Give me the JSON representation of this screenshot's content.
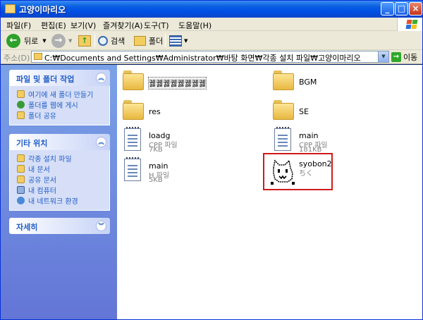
{
  "window": {
    "title": "고양이마리오"
  },
  "menu": [
    "파일(F)",
    "편집(E)",
    "보기(V)",
    "즐겨찾기(A)",
    "도구(T)",
    "도움말(H)"
  ],
  "toolbar": {
    "back": "뒤로",
    "search": "검색",
    "folders": "폴더"
  },
  "address": {
    "label": "주소(D)",
    "path": "C:₩Documents and Settings₩Administrator₩바탕 화면₩각종 설치 파일₩고양이마리오",
    "go": "이동"
  },
  "panels": [
    {
      "title": "파일 및 폴더 작업",
      "links": [
        "여기에 새 폴더 만들기",
        "폴더를 웹에 게시",
        "폴더 공유"
      ]
    },
    {
      "title": "기타 위치",
      "links": [
        "각종 설치 파일",
        "내 문서",
        "공유 문서",
        "내 컴퓨터",
        "내 네트워크 환경"
      ]
    },
    {
      "title": "자세히",
      "links": []
    }
  ],
  "files": [
    {
      "name": "궳궳궳궳궳궳궳궳",
      "kind": "folder"
    },
    {
      "name": "BGM",
      "kind": "folder"
    },
    {
      "name": "res",
      "kind": "folder"
    },
    {
      "name": "SE",
      "kind": "folder"
    },
    {
      "name": "loadg",
      "type": "CPP 파일",
      "size": "7KB",
      "kind": "doc"
    },
    {
      "name": "main",
      "type": "CPP 파일",
      "size": "181KB",
      "kind": "doc"
    },
    {
      "name": "main",
      "type": "H 파일",
      "size": "5KB",
      "kind": "doc"
    },
    {
      "name": "syobon2",
      "type": "ちく",
      "kind": "app"
    }
  ],
  "colors": {
    "titlebar": "#0a5fe0",
    "sidebar": "#7ba2e7",
    "highlight": "#d01a1a",
    "link": "#215dc6"
  }
}
